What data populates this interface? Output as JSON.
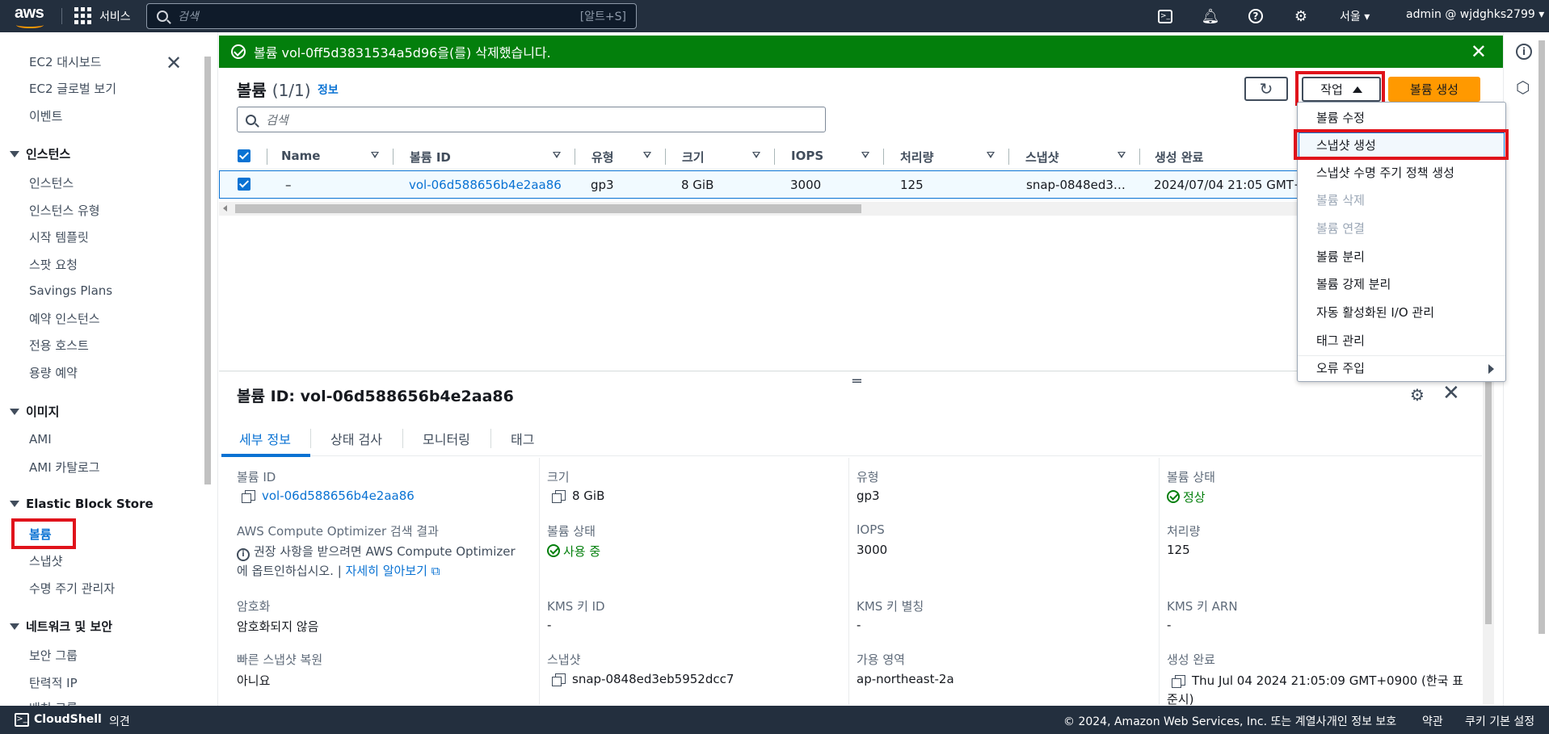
{
  "topnav": {
    "logo": "aws",
    "services": "서비스",
    "search_placeholder": "검색",
    "search_hint": "[알트+S]",
    "region": "서울 ▾",
    "account": "admin @ wjdghks2799 ▾",
    "icons": [
      "cloudshell-icon",
      "notification-bell-icon",
      "help-icon",
      "settings-gear-icon"
    ]
  },
  "sidebar": {
    "top": [
      "EC2 대시보드",
      "EC2 글로벌 보기",
      "이벤트"
    ],
    "sections": [
      {
        "title": "인스턴스",
        "items": [
          "인스턴스",
          "인스턴스 유형",
          "시작 템플릿",
          "스팟 요청",
          "Savings Plans",
          "예약 인스턴스",
          "전용 호스트",
          "용량 예약"
        ]
      },
      {
        "title": "이미지",
        "items": [
          "AMI",
          "AMI 카탈로그"
        ]
      },
      {
        "title": "Elastic Block Store",
        "items": [
          "볼륨",
          "스냅샷",
          "수명 주기 관리자"
        ]
      },
      {
        "title": "네트워크 및 보안",
        "items": [
          "보안 그룹",
          "탄력적 IP",
          "배치 그룹"
        ]
      }
    ]
  },
  "flash": {
    "message": "볼륨 vol-0ff5d3831534a5d96을(를) 삭제했습니다."
  },
  "panel": {
    "title": "볼륨",
    "count": "(1/1)",
    "info": "정보",
    "actions_label": "작업",
    "create_label": "볼륨 생성",
    "filter_placeholder": "검색"
  },
  "table": {
    "columns": [
      "Name",
      "볼륨 ID",
      "유형",
      "크기",
      "IOPS",
      "처리량",
      "스냅샷",
      "생성 완료"
    ],
    "row": {
      "name": "–",
      "volume_id": "vol-06d588656b4e2aa86",
      "type": "gp3",
      "size": "8 GiB",
      "iops": "3000",
      "throughput": "125",
      "snapshot": "snap-0848ed3…",
      "created": "2024/07/04 21:05 GMT+"
    }
  },
  "menu": {
    "items": [
      {
        "label": "볼륨 수정",
        "disabled": false
      },
      {
        "label": "스냅샷 생성",
        "disabled": false
      },
      {
        "label": "스냅샷 수명 주기 정책 생성",
        "disabled": false
      },
      {
        "label": "볼륨 삭제",
        "disabled": true
      },
      {
        "label": "볼륨 연결",
        "disabled": true
      },
      {
        "label": "볼륨 분리",
        "disabled": false
      },
      {
        "label": "볼륨 강제 분리",
        "disabled": false
      },
      {
        "label": "자동 활성화된 I/O 관리",
        "disabled": false
      },
      {
        "label": "태그 관리",
        "disabled": false
      },
      {
        "label": "오류 주입",
        "disabled": false
      }
    ]
  },
  "details": {
    "title": "볼륨 ID: vol-06d588656b4e2aa86",
    "tabs": [
      "세부 정보",
      "상태 검사",
      "모니터링",
      "태그"
    ],
    "fields": {
      "volume_id_label": "볼륨 ID",
      "volume_id": "vol-06d588656b4e2aa86",
      "size_label": "크기",
      "size": "8 GiB",
      "type_label": "유형",
      "type": "gp3",
      "vol_status_label": "볼륨 상태",
      "vol_status": "정상",
      "optimizer_label": "AWS Compute Optimizer 검색 결과",
      "optimizer_text1": "권장 사항을 받으려면 AWS Compute Optimizer",
      "optimizer_text2": "에 옵트인하십시오. |",
      "optimizer_link": "자세히 알아보기",
      "vol_state_label": "볼륨 상태",
      "vol_state": "사용 중",
      "iops_label": "IOPS",
      "iops": "3000",
      "throughput_label": "처리량",
      "throughput": "125",
      "encryption_label": "암호화",
      "encryption": "암호화되지 않음",
      "kms_id_label": "KMS 키 ID",
      "kms_id": "-",
      "kms_alias_label": "KMS 키 별칭",
      "kms_alias": "-",
      "kms_arn_label": "KMS 키 ARN",
      "kms_arn": "-",
      "fast_restore_label": "빠른 스냅샷 복원",
      "fast_restore": "아니요",
      "snapshot_label": "스냅샷",
      "snapshot": "snap-0848ed3eb5952dcc7",
      "az_label": "가용 영역",
      "az": "ap-northeast-2a",
      "created_label": "생성 완료",
      "created1": "Thu Jul 04 2024 21:05:09 GMT+0900 (한국 표",
      "created2": "준시)"
    }
  },
  "footer": {
    "cloudshell": "CloudShell",
    "feedback": "의견",
    "copyright": "© 2024, Amazon Web Services, Inc. 또는 계열사.",
    "privacy": "개인 정보 보호",
    "terms": "약관",
    "cookies": "쿠키 기본 설정"
  },
  "colors": {
    "nav": "#232f3e",
    "success": "#037f0c",
    "link": "#0972d3",
    "primary_button": "#ff9900",
    "highlight": "#e0131b"
  }
}
